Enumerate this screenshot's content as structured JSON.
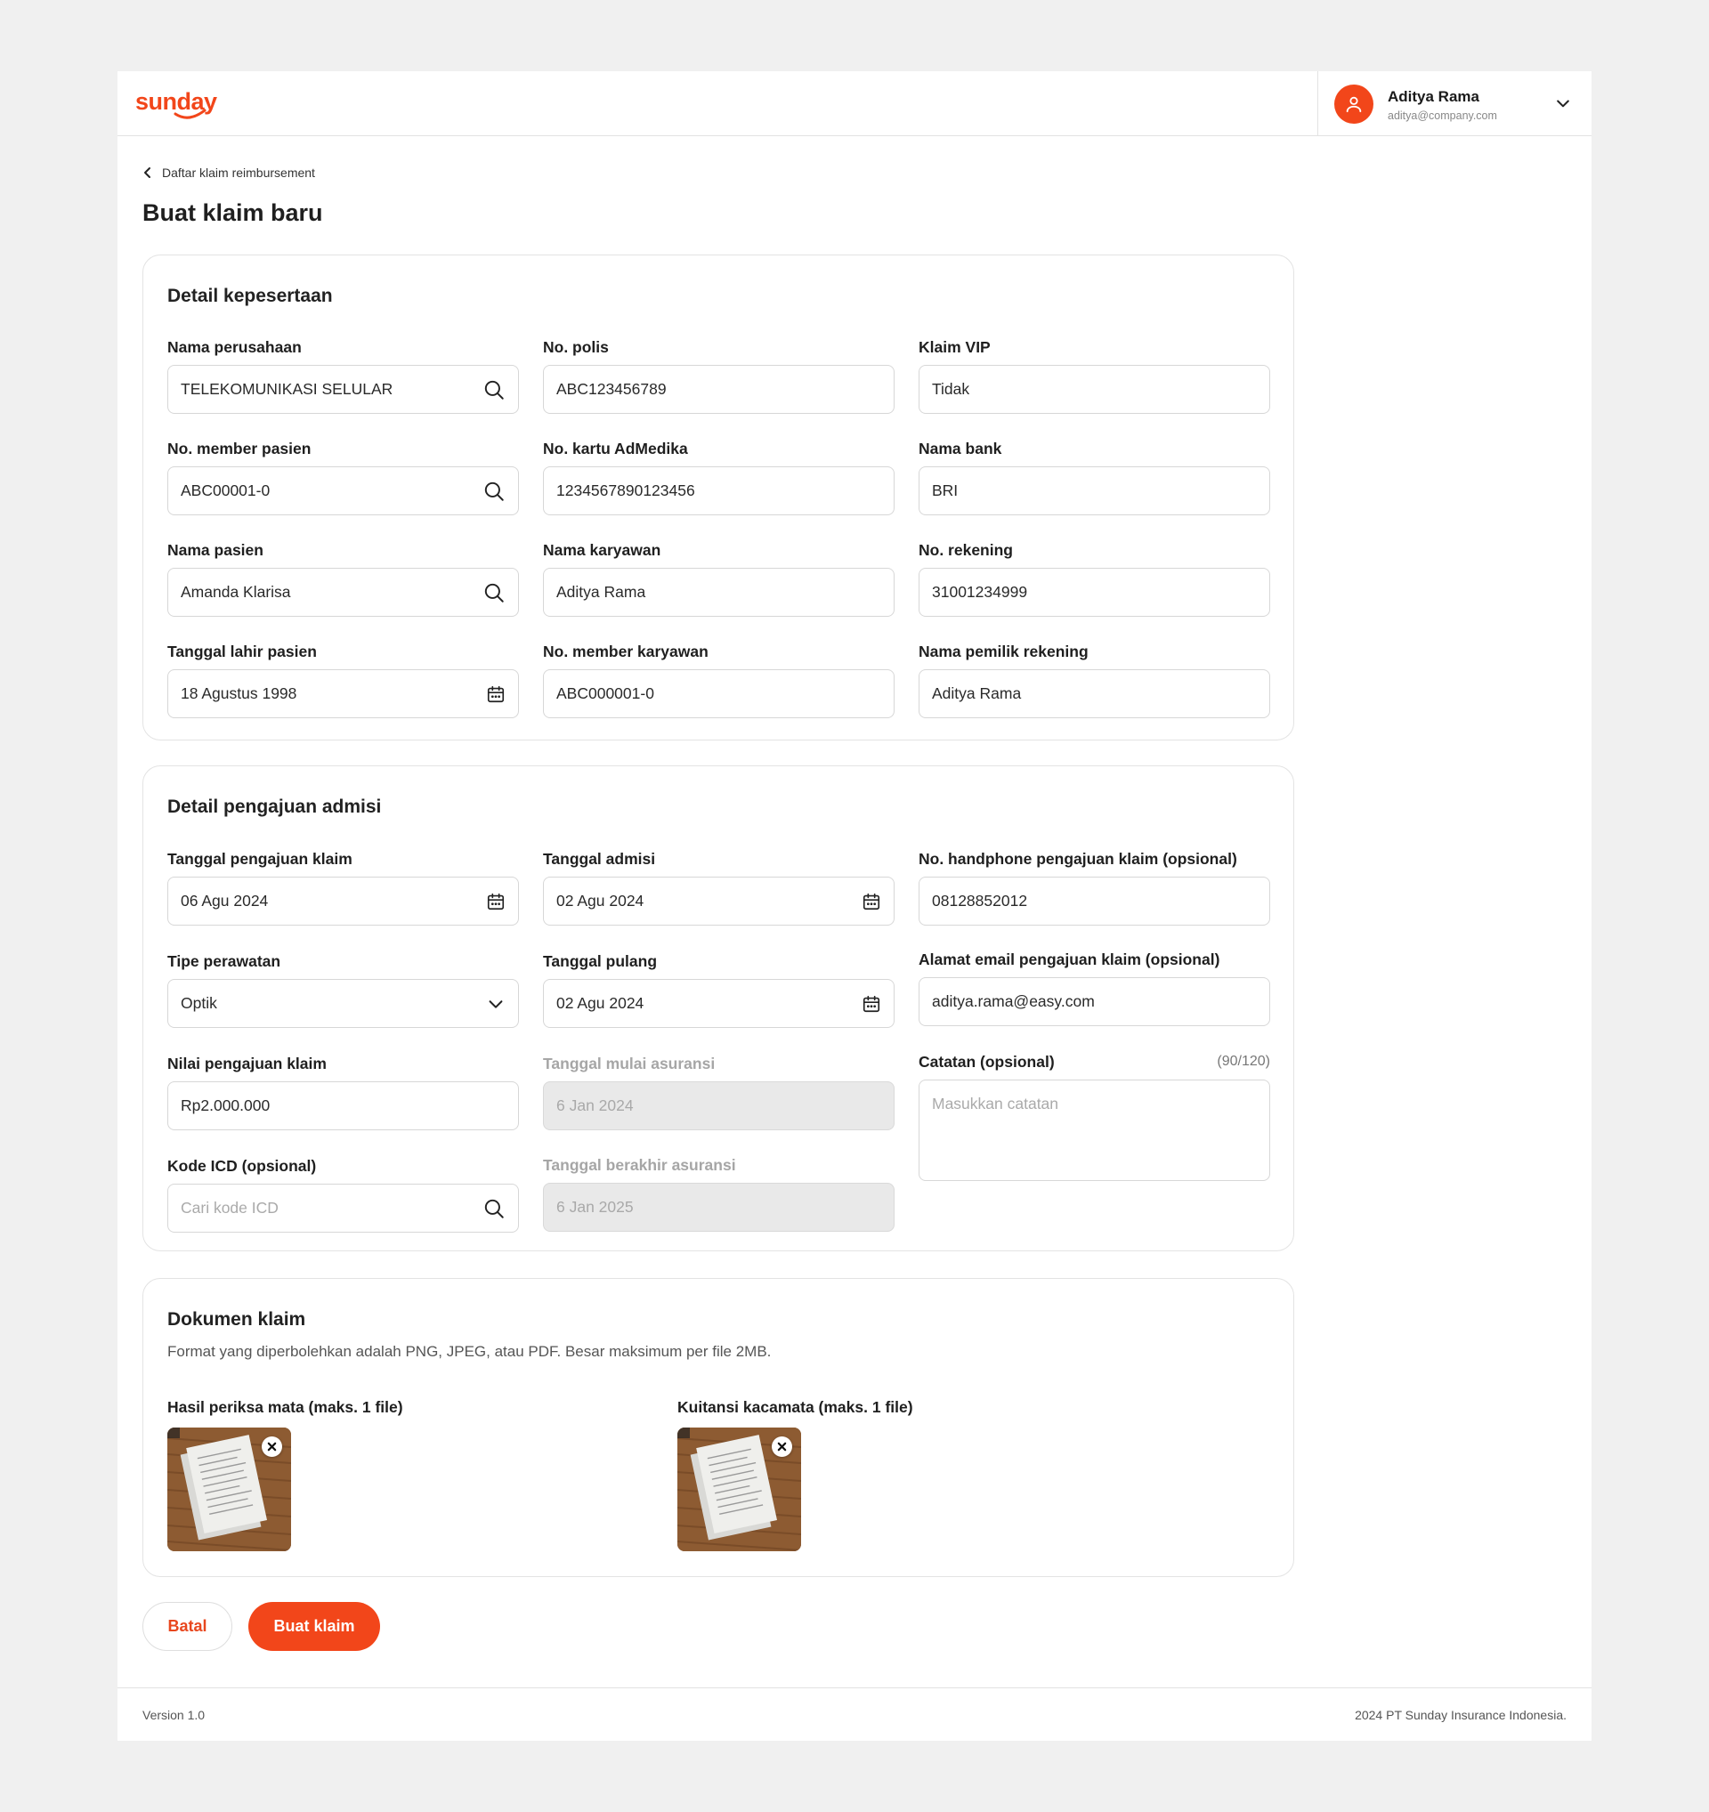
{
  "brand": {
    "logo_text": "sunday",
    "accent": "#f2461a"
  },
  "user": {
    "name": "Aditya Rama",
    "email": "aditya@company.com"
  },
  "breadcrumb": {
    "label": "Daftar klaim reimbursement"
  },
  "page": {
    "title": "Buat klaim baru"
  },
  "membership": {
    "title": "Detail kepesertaan",
    "fields": [
      {
        "label": "Nama perusahaan",
        "value": "TELEKOMUNIKASI SELULAR",
        "icon": "search-icon"
      },
      {
        "label": "No. polis",
        "value": "ABC123456789"
      },
      {
        "label": "Klaim VIP",
        "value": "Tidak"
      },
      {
        "label": "No. member pasien",
        "value": "ABC00001-0",
        "icon": "search-icon"
      },
      {
        "label": "No. kartu AdMedika",
        "value": "1234567890123456"
      },
      {
        "label": "Nama bank",
        "value": "BRI"
      },
      {
        "label": "Nama pasien",
        "value": "Amanda Klarisa",
        "icon": "search-icon"
      },
      {
        "label": "Nama karyawan",
        "value": "Aditya Rama"
      },
      {
        "label": "No. rekening",
        "value": "31001234999"
      },
      {
        "label": "Tanggal lahir pasien",
        "value": "18 Agustus 1998",
        "icon": "calendar-icon"
      },
      {
        "label": "No. member karyawan",
        "value": "ABC000001-0"
      },
      {
        "label": "Nama pemilik rekening",
        "value": "Aditya Rama"
      }
    ]
  },
  "admission": {
    "title": "Detail pengajuan admisi",
    "claim_date": {
      "label": "Tanggal pengajuan klaim",
      "value": "06 Agu 2024"
    },
    "admission_date": {
      "label": "Tanggal admisi",
      "value": "02 Agu 2024"
    },
    "phone": {
      "label": "No. handphone pengajuan klaim (opsional)",
      "value": "08128852012"
    },
    "care_type": {
      "label": "Tipe perawatan",
      "value": "Optik"
    },
    "discharge_date": {
      "label": "Tanggal pulang",
      "value": "02 Agu 2024"
    },
    "email": {
      "label": "Alamat email pengajuan klaim (opsional)",
      "value": "aditya.rama@easy.com"
    },
    "claim_amount": {
      "label": "Nilai pengajuan klaim",
      "value": "Rp2.000.000"
    },
    "insurance_start": {
      "label": "Tanggal mulai asuransi",
      "value": "6 Jan 2024"
    },
    "notes": {
      "label": "Catatan (opsional)",
      "counter": "(90/120)",
      "placeholder": "Masukkan catatan"
    },
    "icd": {
      "label": "Kode ICD (opsional)",
      "placeholder": "Cari kode ICD"
    },
    "insurance_end": {
      "label": "Tanggal berakhir asuransi",
      "value": "6 Jan 2025"
    }
  },
  "documents": {
    "title": "Dokumen klaim",
    "description": "Format yang diperbolehkan adalah PNG, JPEG, atau PDF. Besar maksimum per file 2MB.",
    "groups": [
      {
        "label": "Hasil periksa mata (maks. 1 file)"
      },
      {
        "label": "Kuitansi kacamata (maks. 1 file)"
      }
    ]
  },
  "actions": {
    "cancel": "Batal",
    "submit": "Buat klaim"
  },
  "footer": {
    "version": "Version 1.0",
    "copyright": "2024 PT Sunday Insurance Indonesia."
  }
}
